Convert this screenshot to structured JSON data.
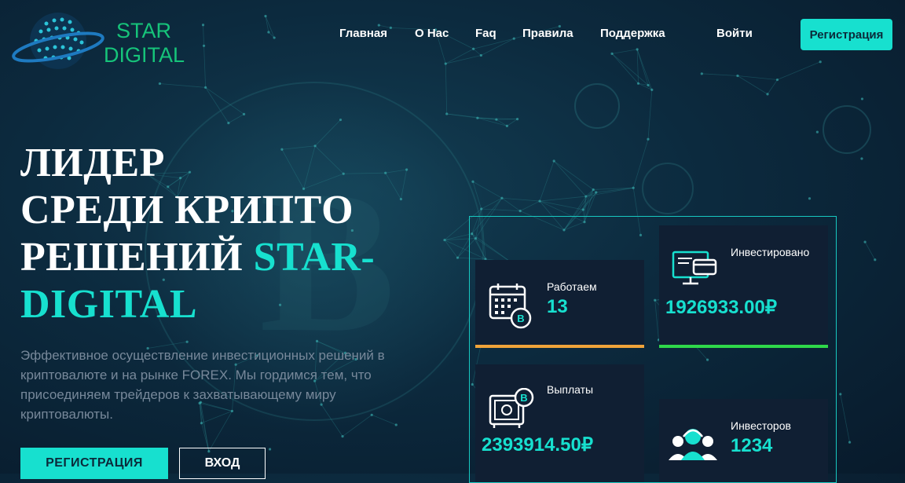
{
  "brand": {
    "line1": "STAR",
    "line2": "DIGITAL",
    "color": "#16c47a"
  },
  "nav": {
    "items": [
      "Главная",
      "О Нас",
      "Faq",
      "Правила",
      "Поддержка"
    ]
  },
  "header": {
    "login_label": "Войти",
    "register_label": "Регистрация"
  },
  "hero": {
    "title_line1": "ЛИДЕР",
    "title_line2": "СРЕДИ КРИПТО",
    "title_line3_a": "РЕШЕНИЙ ",
    "title_line3_b": "STAR-",
    "title_line4": "DIGITAL",
    "description": "Эффективное осуществление инвестиционных решений в криптовалюте и на рынке FOREX. Мы гордимся тем, что присоединяем трейдеров к захватывающему миру криптовалюты.",
    "register_button": "РЕГИСТРАЦИЯ",
    "login_button": "ВХОД"
  },
  "stats": {
    "working": {
      "label": "Работаем",
      "value": "13",
      "icon": "calendar-bitcoin-icon",
      "accent": "#f0a33a"
    },
    "invested": {
      "label": "Инвестировано",
      "value": "1926933.00₽",
      "icon": "monitor-card-icon",
      "accent": "#2fd84a"
    },
    "payouts": {
      "label": "Выплаты",
      "value": "2393914.50₽",
      "icon": "safe-bitcoin-icon"
    },
    "investors": {
      "label": "Инвесторов",
      "value": "1234",
      "icon": "people-headset-icon"
    }
  },
  "colors": {
    "accent": "#17e0cf",
    "background": "#0c2a3e"
  }
}
